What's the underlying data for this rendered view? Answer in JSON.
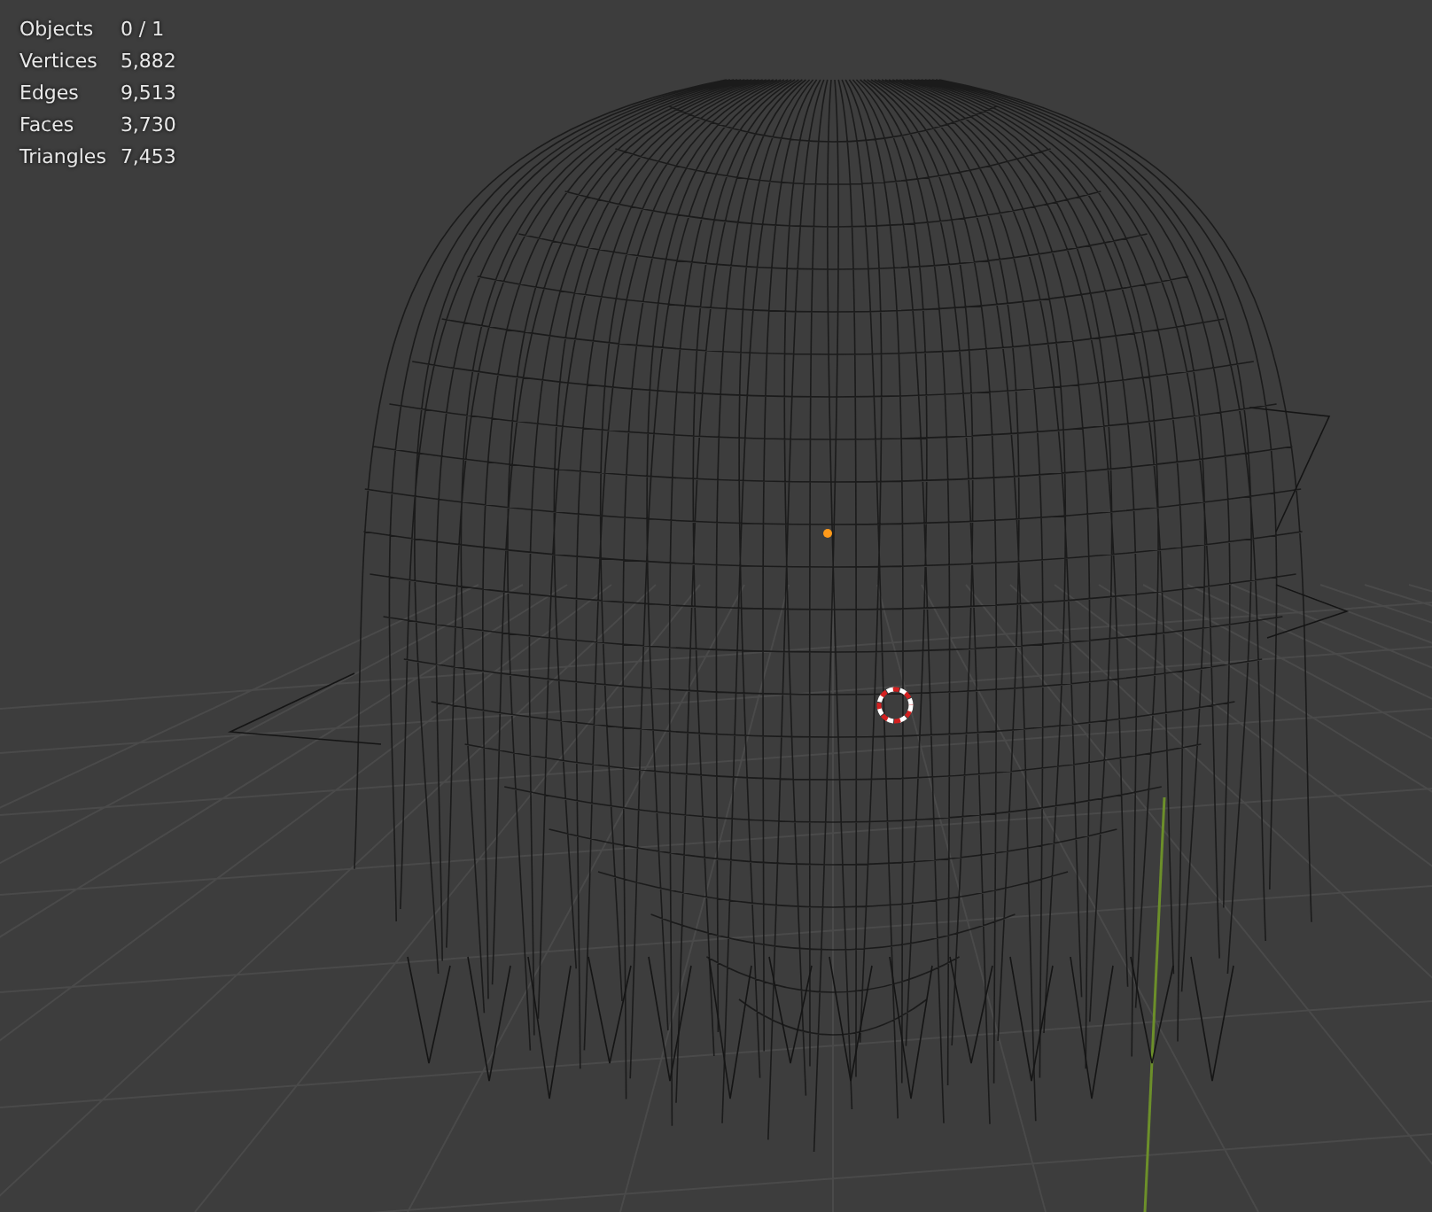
{
  "stats": [
    {
      "label": "Objects",
      "value": "0 / 1"
    },
    {
      "label": "Vertices",
      "value": "5,882"
    },
    {
      "label": "Edges",
      "value": "9,513"
    },
    {
      "label": "Faces",
      "value": "3,730"
    },
    {
      "label": "Triangles",
      "value": "7,453"
    }
  ]
}
